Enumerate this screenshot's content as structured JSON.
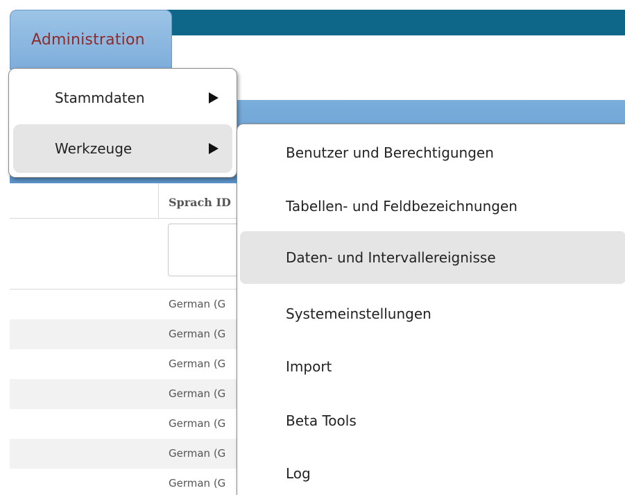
{
  "nav": {
    "admin_tab_label": "Administration"
  },
  "grid": {
    "column_header": "Sprach ID",
    "rows": [
      {
        "language": "German (G"
      },
      {
        "language": "German (G"
      },
      {
        "language": "German (G"
      },
      {
        "language": "German (G"
      },
      {
        "language": "German (G"
      },
      {
        "language": "German (G"
      },
      {
        "language": "German (G"
      }
    ]
  },
  "menu": {
    "level1": [
      {
        "label": "Stammdaten",
        "has_submenu": true,
        "active": false
      },
      {
        "label": "Werkzeuge",
        "has_submenu": true,
        "active": true
      }
    ],
    "level2": [
      {
        "label": "Benutzer und Berechtigungen",
        "highlighted": false
      },
      {
        "label": "Tabellen- und Feldbezeichnungen",
        "highlighted": false
      },
      {
        "label": "Daten- und Intervallereignisse",
        "highlighted": true
      },
      {
        "label": "Systemeinstellungen",
        "highlighted": false
      },
      {
        "label": "Import",
        "highlighted": false
      },
      {
        "label": "Beta Tools",
        "highlighted": false
      },
      {
        "label": "Log",
        "highlighted": false
      }
    ]
  },
  "colors": {
    "top_bar": "#0e6688",
    "tab_background": "#8fb8e0",
    "tab_text": "#8e2b2b",
    "menu_highlight": "#e5e5e5",
    "band_blue": "#6da2d4"
  }
}
